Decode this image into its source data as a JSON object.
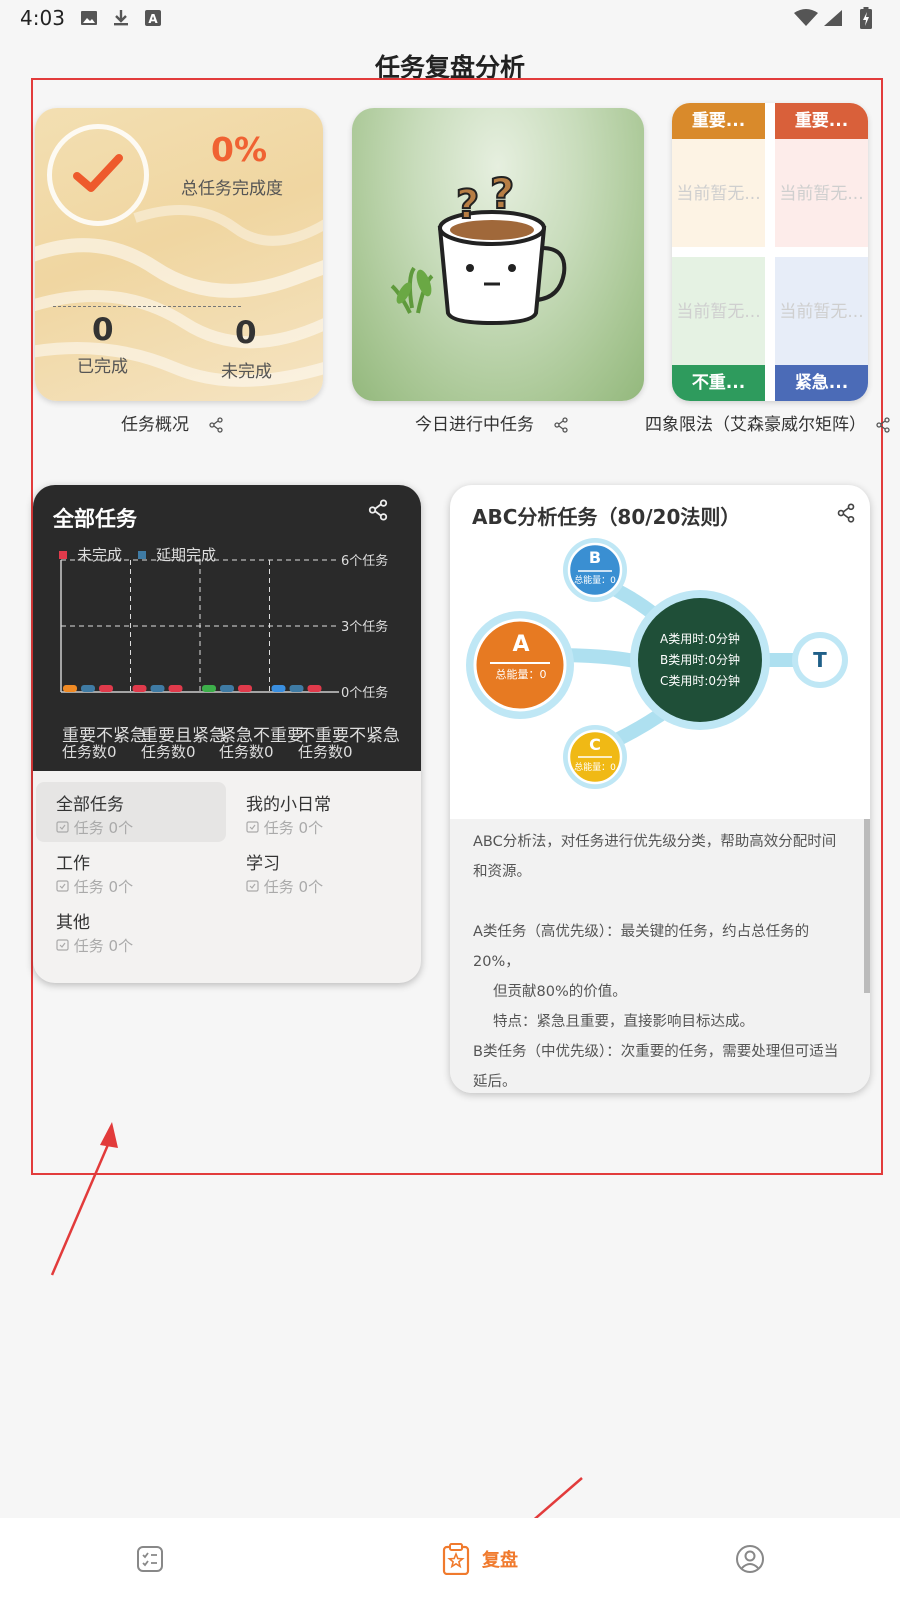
{
  "status_bar": {
    "time": "4:03"
  },
  "page": {
    "title": "任务复盘分析"
  },
  "overview": {
    "percent": "0%",
    "percent_label": "总任务完成度",
    "completed_value": "0",
    "completed_label": "已完成",
    "uncompleted_value": "0",
    "uncompleted_label": "未完成",
    "caption": "任务概况"
  },
  "today": {
    "caption": "今日进行中任务"
  },
  "matrix": {
    "caption": "四象限法（艾森豪威尔矩阵）",
    "q1_head": "重要...",
    "q2_head": "重要...",
    "q3_foot": "不重...",
    "q4_foot": "紧急...",
    "empty_text": "当前暂无...",
    "colors": {
      "q1": "#d98a2b",
      "q2": "#d9603a",
      "q3": "#2e9b5d",
      "q4": "#4b6bb7"
    }
  },
  "all_tasks": {
    "title": "全部任务",
    "legend": [
      {
        "label": "未完成",
        "color": "#e03a4b"
      },
      {
        "label": "延期完成",
        "color": "#3f7ba4"
      }
    ],
    "lists": [
      {
        "name": "全部任务",
        "count": "任务 0个"
      },
      {
        "name": "我的小日常",
        "count": "任务 0个"
      },
      {
        "name": "工作",
        "count": "任务 0个"
      },
      {
        "name": "学习",
        "count": "任务 0个"
      },
      {
        "name": "其他",
        "count": "任务 0个"
      }
    ],
    "chart_data": {
      "type": "bar",
      "categories": [
        "重要不紧急",
        "重要且紧急",
        "紧急不重要",
        "不重要不紧急"
      ],
      "category_counts": [
        "任务数0",
        "任务数0",
        "任务数0",
        "任务数0"
      ],
      "series": [
        {
          "name": "未完成",
          "values": [
            0,
            0,
            0,
            0
          ]
        },
        {
          "name": "延期完成",
          "values": [
            0,
            0,
            0,
            0
          ]
        }
      ],
      "y_ticks": [
        "6个任务",
        "3个任务",
        "0个任务"
      ],
      "ylim": [
        0,
        6
      ],
      "grid": true,
      "legend": "top-left"
    }
  },
  "abc": {
    "title": "ABC分析任务（80/20法则）",
    "node_a": "A",
    "node_b": "B",
    "node_c": "C",
    "node_t": "T",
    "total_a": "总能量：0",
    "total_b": "总能量：0",
    "total_c": "总能量：0",
    "time_a": "A类用时:0分钟",
    "time_b": "B类用时:0分钟",
    "time_c": "C类用时:0分钟",
    "desc": [
      "ABC分析法，对任务进行优先级分类，帮助高效分配时间和资源。",
      "",
      "A类任务（高优先级）：最关键的任务，约占总任务的20%，",
      "但贡献80%的价值。",
      "特点：紧急且重要，直接影响目标达成。",
      "B类任务（中优先级）：次重要的任务，需要处理但可适当延后。"
    ]
  },
  "nav": {
    "review_label": "复盘",
    "accent": "#f07a2d"
  }
}
